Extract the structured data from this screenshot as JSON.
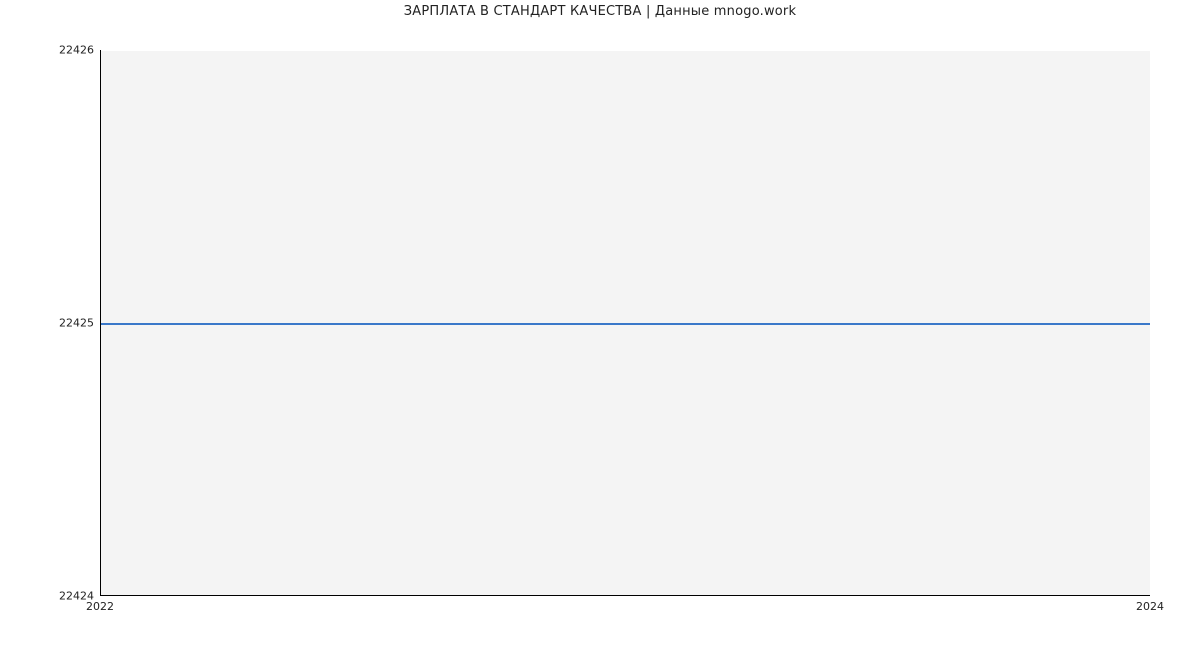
{
  "chart_data": {
    "type": "line",
    "title": "ЗАРПЛАТА В  СТАНДАРТ КАЧЕСТВА | Данные mnogo.work",
    "x": [
      2022,
      2024
    ],
    "values": [
      22425,
      22425
    ],
    "xlabel": "",
    "ylabel": "",
    "xlim": [
      2022,
      2024
    ],
    "ylim": [
      22424,
      22426
    ],
    "yticks": [
      22424,
      22425,
      22426
    ],
    "xticks": [
      2022,
      2024
    ]
  },
  "ticks": {
    "y0": "22424",
    "y1": "22425",
    "y2": "22426",
    "x0": "2022",
    "x1": "2024"
  }
}
